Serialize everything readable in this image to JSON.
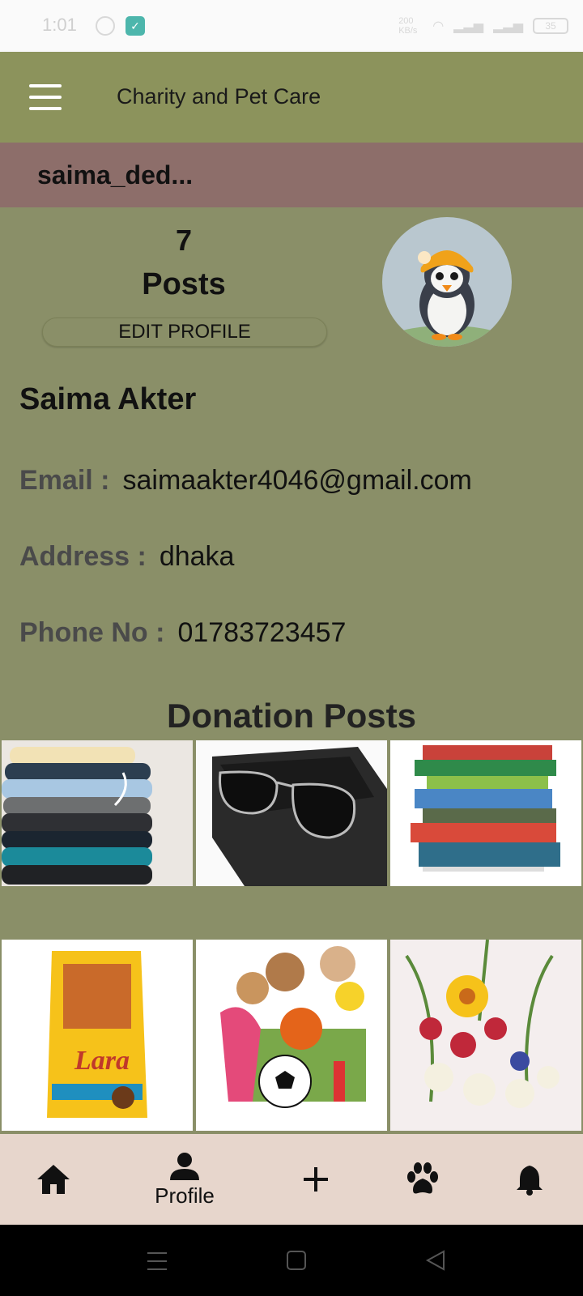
{
  "status_bar": {
    "time": "1:01",
    "network_text": "200 KB/s",
    "battery": "35"
  },
  "app_bar": {
    "title": "Charity and Pet Care"
  },
  "profile": {
    "username": "saima_ded...",
    "posts_count": "7",
    "posts_label": "Posts",
    "edit_button": "EDIT PROFILE",
    "full_name": "Saima Akter",
    "email_label": "Email :",
    "email": "saimaakter4046@gmail.com",
    "address_label": "Address :",
    "address": "dhaka",
    "phone_label": "Phone No :",
    "phone": "01783723457"
  },
  "donations": {
    "title": "Donation Posts",
    "items": [
      "clothes",
      "sunglasses",
      "books",
      "cat-food",
      "toys",
      "flowers"
    ]
  },
  "bottom_nav": {
    "items": [
      {
        "icon": "home-icon",
        "label": ""
      },
      {
        "icon": "person-icon",
        "label": "Profile"
      },
      {
        "icon": "plus-icon",
        "label": ""
      },
      {
        "icon": "paw-icon",
        "label": ""
      },
      {
        "icon": "bell-icon",
        "label": ""
      }
    ]
  },
  "colors": {
    "app_bar": "#8c935c",
    "background": "#8a8f68",
    "user_bar": "#8d6e6a",
    "bottom_nav": "#e7d6cc"
  }
}
